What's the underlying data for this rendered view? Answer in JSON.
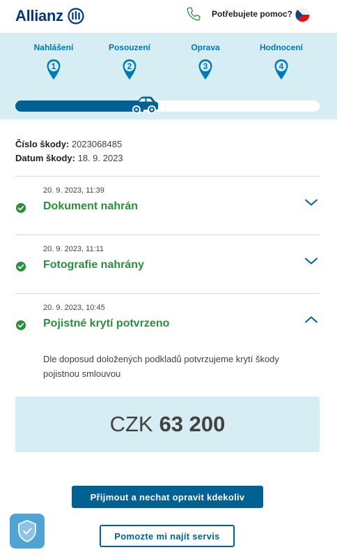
{
  "header": {
    "logo_text": "Allianz",
    "help_text": "Potřebujete pomoc?",
    "logo_icon": "allianz-eagle-icon",
    "phone_icon": "phone-icon",
    "flag_icon": "czech-flag-icon"
  },
  "progress": {
    "steps": [
      {
        "label": "Nahlášení",
        "number": "1"
      },
      {
        "label": "Posouzení",
        "number": "2"
      },
      {
        "label": "Oprava",
        "number": "3"
      },
      {
        "label": "Hodnocení",
        "number": "4"
      }
    ],
    "completion": 0.42
  },
  "claim": {
    "number_label": "Číslo škody:",
    "number_value": "2023068485",
    "date_label": "Datum škody:",
    "date_value": "18. 9. 2023"
  },
  "timeline": [
    {
      "date": "20. 9. 2023, 11:39",
      "title": "Dokument nahrán",
      "expanded": false
    },
    {
      "date": "20. 9. 2023, 11:11",
      "title": "Fotografie nahrány",
      "expanded": false
    },
    {
      "date": "20. 9. 2023, 10:45",
      "title": "Pojistné krytí potvrzeno",
      "expanded": true,
      "description": "Dle doposud doložených podkladů potvrzujeme krytí škody pojistnou smlouvou"
    }
  ],
  "amount": {
    "currency": "CZK",
    "value": "63 200"
  },
  "actions": {
    "primary_label": "Přijmout a nechat opravit kdekoliv",
    "secondary_label": "Pomozte mi najít servis"
  },
  "colors": {
    "brand": "#003781",
    "accent": "#006192",
    "step_text": "#007ab3",
    "success": "#2a8f3c",
    "panel": "#d5edf3"
  }
}
